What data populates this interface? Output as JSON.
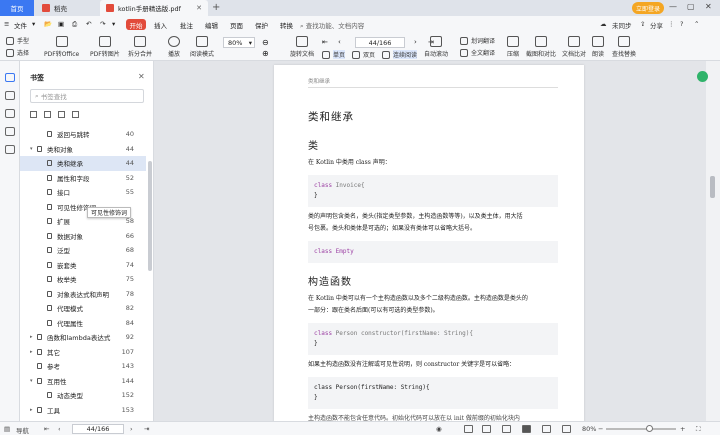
{
  "tabs": {
    "home": "首页",
    "doc1": "稻壳",
    "doc2": "kotlin手册精选版.pdf",
    "login": "立即登录"
  },
  "menu": {
    "file": "文件",
    "start": "开始",
    "items": [
      "插入",
      "批注",
      "编辑",
      "页面",
      "保护",
      "转换"
    ],
    "search_placeholder": "查找功能、文档内容",
    "cloud": "未同步",
    "share": "分享"
  },
  "toolbar": {
    "hand": "手型",
    "select": "选择",
    "pdf_office": "PDF转Office",
    "pdf_image": "PDF转图片",
    "split_merge": "拆分合并",
    "play": "播放",
    "read_mode": "阅读模式",
    "zoom": "80%",
    "rotate": "旋转文档",
    "single": "单页",
    "double": "双页",
    "continuous": "连续阅读",
    "auto_scroll": "自动滚动",
    "page": "44/166",
    "translate_word": "划词翻译",
    "translate_full": "全文翻译",
    "compress": "压缩",
    "screenshot": "截图和对比",
    "compare": "文档比对",
    "read_aloud": "朗读",
    "find_replace": "查找替换"
  },
  "outline": {
    "title": "书签",
    "search_placeholder": "书签查找",
    "tooltip": "可见性修饰词",
    "items": [
      {
        "label": "返回与跳转",
        "page": "40",
        "level": 1,
        "expand": ""
      },
      {
        "label": "类和对象",
        "page": "44",
        "level": 0,
        "expand": "▾"
      },
      {
        "label": "类和继承",
        "page": "44",
        "level": 1,
        "expand": "",
        "selected": true
      },
      {
        "label": "属性和字段",
        "page": "52",
        "level": 1,
        "expand": ""
      },
      {
        "label": "接口",
        "page": "55",
        "level": 1,
        "expand": ""
      },
      {
        "label": "可见性修饰词",
        "page": "",
        "level": 1,
        "expand": ""
      },
      {
        "label": "扩展",
        "page": "58",
        "level": 1,
        "expand": ""
      },
      {
        "label": "数据对象",
        "page": "66",
        "level": 1,
        "expand": ""
      },
      {
        "label": "泛型",
        "page": "68",
        "level": 1,
        "expand": ""
      },
      {
        "label": "嵌套类",
        "page": "74",
        "level": 1,
        "expand": ""
      },
      {
        "label": "枚举类",
        "page": "75",
        "level": 1,
        "expand": ""
      },
      {
        "label": "对象表达式和声明",
        "page": "78",
        "level": 1,
        "expand": ""
      },
      {
        "label": "代理模式",
        "page": "82",
        "level": 1,
        "expand": ""
      },
      {
        "label": "代理属性",
        "page": "84",
        "level": 1,
        "expand": ""
      },
      {
        "label": "函数和lambda表达式",
        "page": "92",
        "level": 0,
        "expand": "▸"
      },
      {
        "label": "其它",
        "page": "107",
        "level": 0,
        "expand": "▸"
      },
      {
        "label": "参考",
        "page": "143",
        "level": 0,
        "expand": ""
      },
      {
        "label": "互用性",
        "page": "144",
        "level": 0,
        "expand": "▾"
      },
      {
        "label": "动态类型",
        "page": "152",
        "level": 1,
        "expand": ""
      },
      {
        "label": "工具",
        "page": "153",
        "level": 0,
        "expand": "▸"
      }
    ]
  },
  "document": {
    "running_header": "类和继承",
    "h1": "类和继承",
    "h2_class": "类",
    "p1": "在 Kotlin 中类用 class 声明：",
    "code1_kw": "class",
    "code1_name": " Invoice{",
    "code1_end": "}",
    "p2_l1": "类的声明包含类名，类头(指定类型参数，主构造函数等等)，以及类主体，用大括",
    "p2_l2": "号包裹。类头和类体是可选的；如果没有类体可以省略大括号。",
    "code2": "class Empty",
    "h2_ctor": "构造函数",
    "p3_l1": "在 Kotlin 中类可以有一个主构造函数以及多个二级构造函数。主构造函数是类头的",
    "p3_l2": "一部分：跟在类名后面(可以有可选的类型参数)。",
    "code3_l1_kw": "class",
    "code3_l1_rest": " Person constructor(firstName: String){",
    "code3_l2": "}",
    "p4": "如果主构造函数没有注解或可见性说明，则 constructor 关键字是可以省略：",
    "code4_l1": "class Person(firstName: String){",
    "code4_l2": "}",
    "p5": "主构造函数不能包含任意代码。初始化代码可以放在以 init 做前缀的初始化块内"
  },
  "status": {
    "nav": "导航",
    "page": "44/166",
    "zoom": "80%"
  }
}
